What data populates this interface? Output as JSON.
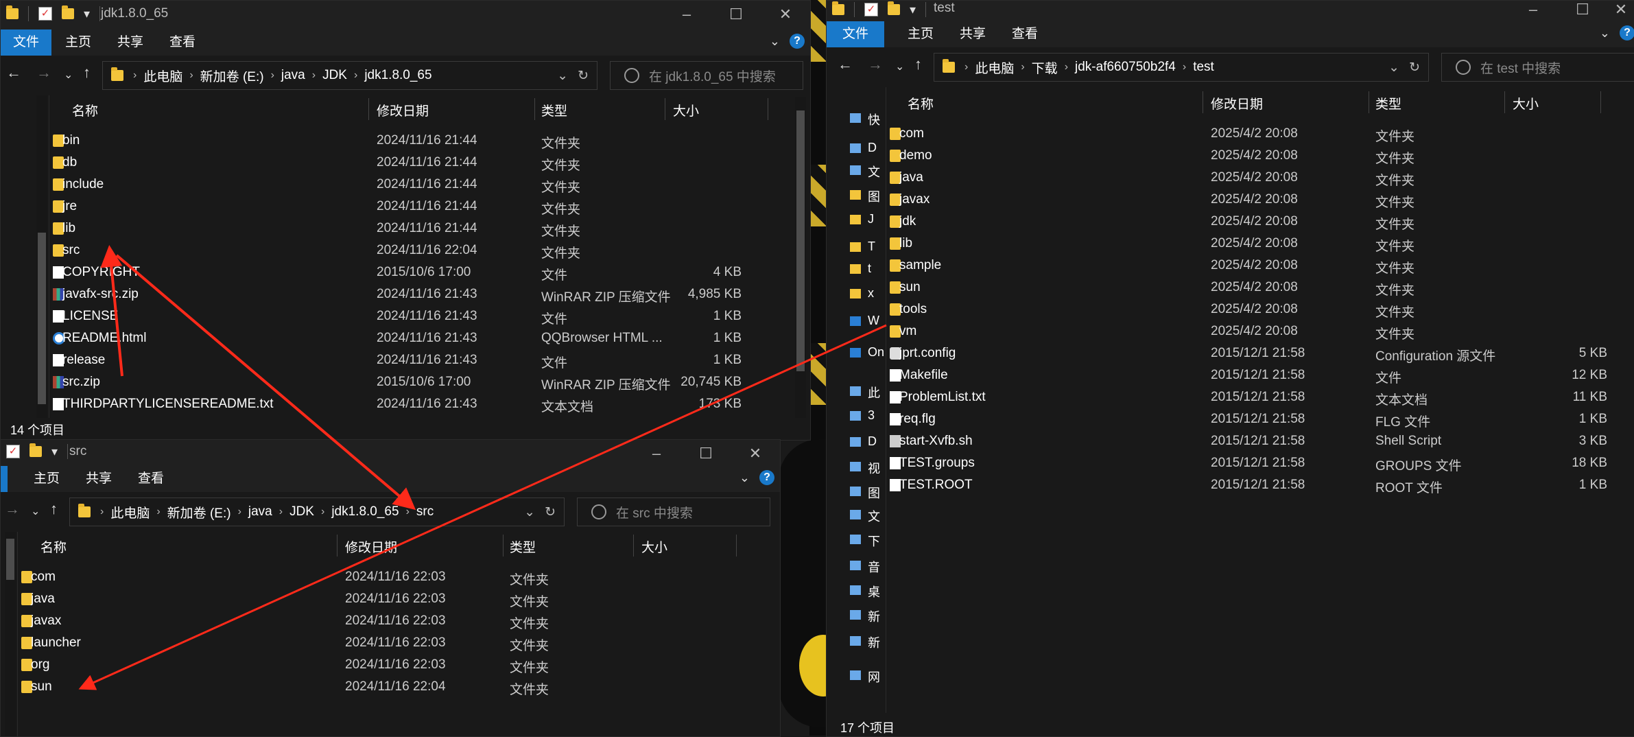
{
  "accent_color": "#1979ca",
  "arrow_color": "#ff2a1a",
  "ribbon": {
    "file": "文件",
    "home": "主页",
    "share": "共享",
    "view": "查看"
  },
  "win1": {
    "title": "jdk1.8.0_65",
    "breadcrumb": [
      "此电脑",
      "新加卷 (E:)",
      "java",
      "JDK",
      "jdk1.8.0_65"
    ],
    "search_placeholder": "在 jdk1.8.0_65 中搜索",
    "columns": {
      "name": "名称",
      "date": "修改日期",
      "type": "类型",
      "size": "大小"
    },
    "status": "14 个项目",
    "files": [
      {
        "icon": "folder",
        "name": "bin",
        "date": "2024/11/16 21:44",
        "type": "文件夹",
        "size": ""
      },
      {
        "icon": "folder",
        "name": "db",
        "date": "2024/11/16 21:44",
        "type": "文件夹",
        "size": ""
      },
      {
        "icon": "folder",
        "name": "include",
        "date": "2024/11/16 21:44",
        "type": "文件夹",
        "size": ""
      },
      {
        "icon": "folder",
        "name": "jre",
        "date": "2024/11/16 21:44",
        "type": "文件夹",
        "size": ""
      },
      {
        "icon": "folder",
        "name": "lib",
        "date": "2024/11/16 21:44",
        "type": "文件夹",
        "size": ""
      },
      {
        "icon": "folder",
        "name": "src",
        "date": "2024/11/16 22:04",
        "type": "文件夹",
        "size": ""
      },
      {
        "icon": "doc",
        "name": "COPYRIGHT",
        "date": "2015/10/6 17:00",
        "type": "文件",
        "size": "4 KB"
      },
      {
        "icon": "zip",
        "name": "javafx-src.zip",
        "date": "2024/11/16 21:43",
        "type": "WinRAR ZIP 压缩文件",
        "size": "4,985 KB"
      },
      {
        "icon": "doc",
        "name": "LICENSE",
        "date": "2024/11/16 21:43",
        "type": "文件",
        "size": "1 KB"
      },
      {
        "icon": "qq",
        "name": "README.html",
        "date": "2024/11/16 21:43",
        "type": "QQBrowser HTML ...",
        "size": "1 KB"
      },
      {
        "icon": "doc",
        "name": "release",
        "date": "2024/11/16 21:43",
        "type": "文件",
        "size": "1 KB"
      },
      {
        "icon": "zip",
        "name": "src.zip",
        "date": "2015/10/6 17:00",
        "type": "WinRAR ZIP 压缩文件",
        "size": "20,745 KB"
      },
      {
        "icon": "doc",
        "name": "THIRDPARTYLICENSEREADME.txt",
        "date": "2024/11/16 21:43",
        "type": "文本文档",
        "size": "173 KB"
      }
    ]
  },
  "win2": {
    "title": "src",
    "breadcrumb": [
      "此电脑",
      "新加卷 (E:)",
      "java",
      "JDK",
      "jdk1.8.0_65",
      "src"
    ],
    "search_placeholder": "在 src 中搜索",
    "columns": {
      "name": "名称",
      "date": "修改日期",
      "type": "类型",
      "size": "大小"
    },
    "files": [
      {
        "icon": "folder",
        "name": "com",
        "date": "2024/11/16 22:03",
        "type": "文件夹",
        "size": ""
      },
      {
        "icon": "folder",
        "name": "java",
        "date": "2024/11/16 22:03",
        "type": "文件夹",
        "size": ""
      },
      {
        "icon": "folder",
        "name": "javax",
        "date": "2024/11/16 22:03",
        "type": "文件夹",
        "size": ""
      },
      {
        "icon": "folder",
        "name": "launcher",
        "date": "2024/11/16 22:03",
        "type": "文件夹",
        "size": ""
      },
      {
        "icon": "folder",
        "name": "org",
        "date": "2024/11/16 22:03",
        "type": "文件夹",
        "size": ""
      },
      {
        "icon": "folder",
        "name": "sun",
        "date": "2024/11/16 22:04",
        "type": "文件夹",
        "size": ""
      }
    ]
  },
  "win3": {
    "title": "test",
    "breadcrumb": [
      "此电脑",
      "下载",
      "jdk-af660750b2f4",
      "test"
    ],
    "search_placeholder": "在 test 中搜索",
    "columns": {
      "name": "名称",
      "date": "修改日期",
      "type": "类型",
      "size": "大小"
    },
    "status": "17 个项目",
    "sidebar_labels": [
      "快",
      "D",
      "文",
      "图",
      "J",
      "T",
      "t",
      "x",
      "W",
      "On",
      "此",
      "3",
      "D",
      "视",
      "图",
      "文",
      "下",
      "音",
      "桌",
      "新",
      "新",
      "网"
    ],
    "files": [
      {
        "icon": "folder",
        "name": "com",
        "date": "2025/4/2 20:08",
        "type": "文件夹",
        "size": ""
      },
      {
        "icon": "folder",
        "name": "demo",
        "date": "2025/4/2 20:08",
        "type": "文件夹",
        "size": ""
      },
      {
        "icon": "folder",
        "name": "java",
        "date": "2025/4/2 20:08",
        "type": "文件夹",
        "size": ""
      },
      {
        "icon": "folder",
        "name": "javax",
        "date": "2025/4/2 20:08",
        "type": "文件夹",
        "size": ""
      },
      {
        "icon": "folder",
        "name": "jdk",
        "date": "2025/4/2 20:08",
        "type": "文件夹",
        "size": ""
      },
      {
        "icon": "folder",
        "name": "lib",
        "date": "2025/4/2 20:08",
        "type": "文件夹",
        "size": ""
      },
      {
        "icon": "folder",
        "name": "sample",
        "date": "2025/4/2 20:08",
        "type": "文件夹",
        "size": ""
      },
      {
        "icon": "folder",
        "name": "sun",
        "date": "2025/4/2 20:08",
        "type": "文件夹",
        "size": ""
      },
      {
        "icon": "folder",
        "name": "tools",
        "date": "2025/4/2 20:08",
        "type": "文件夹",
        "size": ""
      },
      {
        "icon": "folder",
        "name": "vm",
        "date": "2025/4/2 20:08",
        "type": "文件夹",
        "size": ""
      },
      {
        "icon": "cfg",
        "name": "jprt.config",
        "date": "2015/12/1 21:58",
        "type": "Configuration 源文件",
        "size": "5 KB"
      },
      {
        "icon": "doc",
        "name": "Makefile",
        "date": "2015/12/1 21:58",
        "type": "文件",
        "size": "12 KB"
      },
      {
        "icon": "doc",
        "name": "ProblemList.txt",
        "date": "2015/12/1 21:58",
        "type": "文本文档",
        "size": "11 KB"
      },
      {
        "icon": "doc",
        "name": "req.flg",
        "date": "2015/12/1 21:58",
        "type": "FLG 文件",
        "size": "1 KB"
      },
      {
        "icon": "sh",
        "name": "start-Xvfb.sh",
        "date": "2015/12/1 21:58",
        "type": "Shell Script",
        "size": "3 KB"
      },
      {
        "icon": "doc",
        "name": "TEST.groups",
        "date": "2015/12/1 21:58",
        "type": "GROUPS 文件",
        "size": "18 KB"
      },
      {
        "icon": "doc",
        "name": "TEST.ROOT",
        "date": "2015/12/1 21:58",
        "type": "ROOT 文件",
        "size": "1 KB"
      }
    ]
  }
}
